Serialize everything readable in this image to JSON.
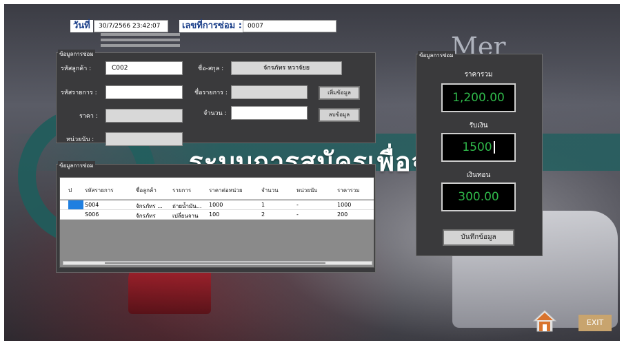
{
  "header": {
    "date_label": "วันที่",
    "date_value": "30/7/2566 23:42:07",
    "repair_no_label": "เลขที่การซ่อม :",
    "repair_no_value": "0007"
  },
  "background": {
    "banner_text": "ระบบการสมัครเพื่อจัดการอู่",
    "brand_text": "Mer"
  },
  "repair_info": {
    "title": "ข้อมูลการซ่อม",
    "customer_code_label": "รหัสลูกค้า :",
    "customer_code_value": "C002",
    "fullname_label": "ชื่อ-สกุล :",
    "fullname_value": "จักรภัทร หวาจัยย",
    "item_code_label": "รหัสรายการ :",
    "item_code_value": "",
    "item_name_label": "ชื่อรายการ :",
    "item_name_value": "",
    "price_label": "ราคา :",
    "price_value": "",
    "quantity_label": "จำนวน :",
    "quantity_value": "",
    "unit_label": "หน่วยนับ :",
    "unit_value": "",
    "add_button": "เพิ่มข้อมูล",
    "delete_button": "ลบข้อมูล"
  },
  "repair_list": {
    "title": "ข้อมูลการซ่อม",
    "columns": [
      "ป",
      "รหัสรายการ",
      "ชื่อลูกค้า",
      "รายการ",
      "ราคาต่อหน่วย",
      "จำนวน",
      "หน่วยนับ",
      "ราคารวม"
    ],
    "rows": [
      {
        "code": "S004",
        "customer": "จักรภัทร ...",
        "item": "ถ่ายน้ำมัน...",
        "unit_price": "1000",
        "qty": "1",
        "unit": "-",
        "total": "1000"
      },
      {
        "code": "S006",
        "customer": "จักรภัทร",
        "item": "เปลี่ยนจาน",
        "unit_price": "100",
        "qty": "2",
        "unit": "-",
        "total": "200"
      }
    ]
  },
  "payment": {
    "title": "ข้อมูลการซ่อม",
    "total_label": "ราคารวม",
    "total_value": "1,200.00",
    "received_label": "รับเงิน",
    "received_value": "1500",
    "change_label": "เงินทอน",
    "change_value": "300.00",
    "save_button": "บันทึกข้อมูล"
  },
  "footer": {
    "exit_label": "EXIT"
  },
  "colors": {
    "panel": "#3a3a3c",
    "lcd_text": "#2fb84a",
    "exit_bg": "#c8a46e",
    "header_text": "#1b3f8a"
  }
}
